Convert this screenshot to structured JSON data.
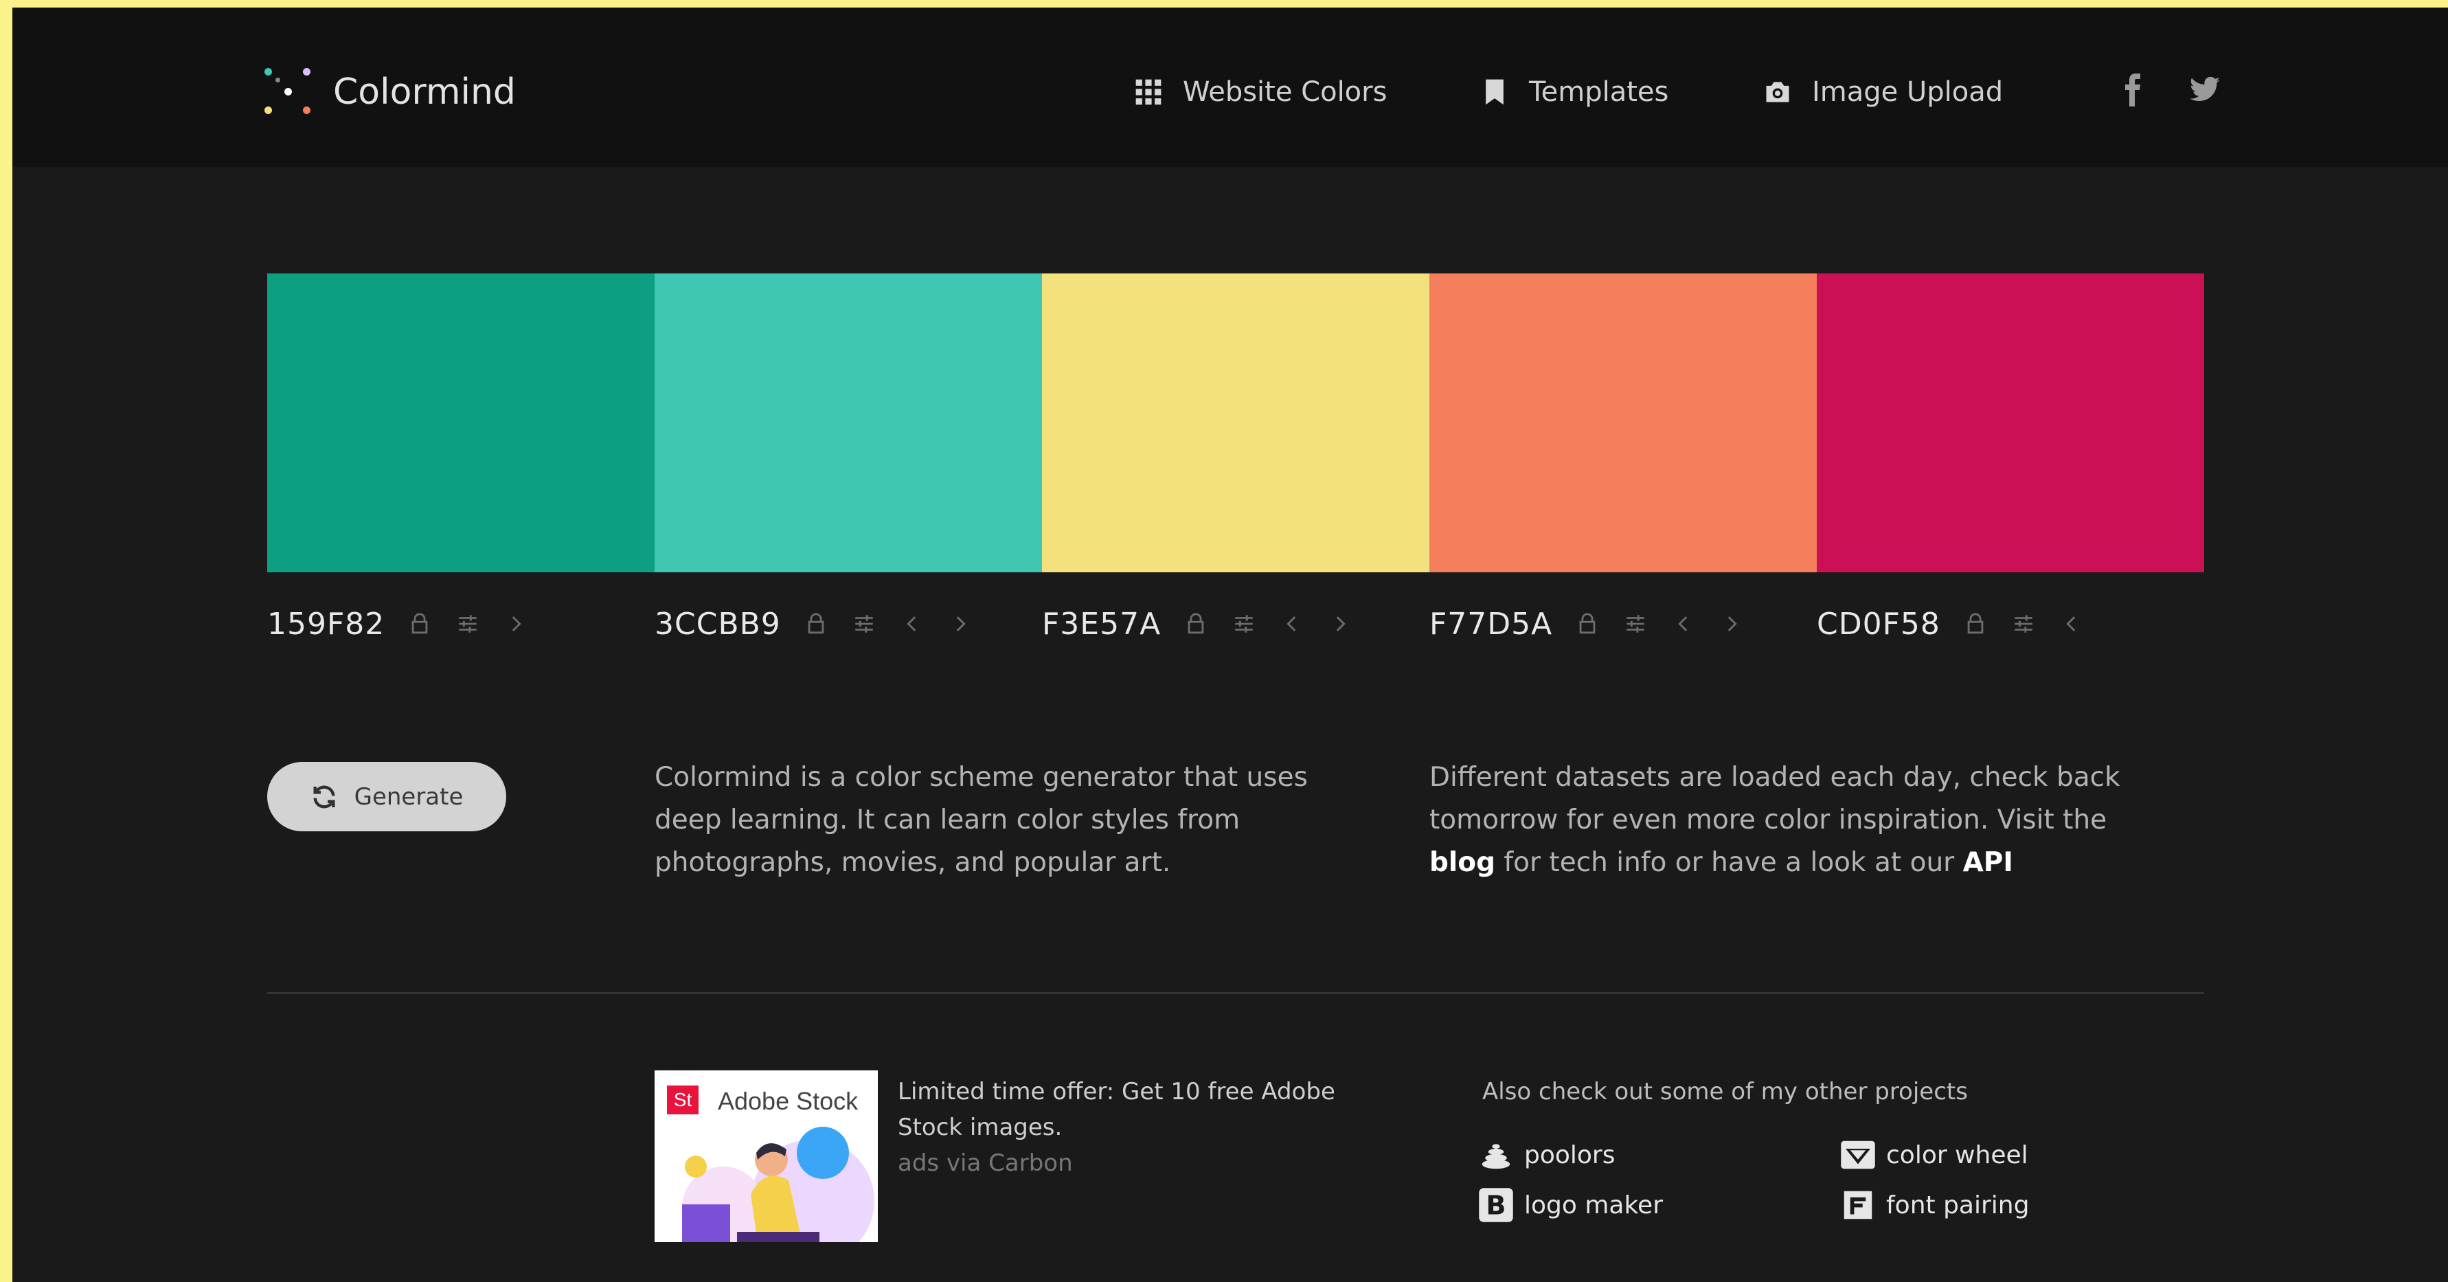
{
  "header": {
    "brand": "Colormind",
    "nav": [
      {
        "label": "Website Colors",
        "icon": "grid-icon"
      },
      {
        "label": "Templates",
        "icon": "bookmark-icon"
      },
      {
        "label": "Image Upload",
        "icon": "camera-icon"
      }
    ],
    "social": [
      {
        "icon": "facebook-icon"
      },
      {
        "icon": "twitter-icon"
      }
    ]
  },
  "palette": [
    {
      "hex": "159F82",
      "color": "#0c9f82",
      "controls": [
        "lock-icon",
        "adjust-icon",
        "chevron-right-icon"
      ]
    },
    {
      "hex": "3CCBB9",
      "color": "#3fc7b4",
      "controls": [
        "lock-icon",
        "adjust-icon",
        "chevron-left-icon",
        "chevron-right-icon"
      ]
    },
    {
      "hex": "F3E57A",
      "color": "#f2e17c",
      "controls": [
        "lock-icon",
        "adjust-icon",
        "chevron-left-icon",
        "chevron-right-icon"
      ]
    },
    {
      "hex": "F77D5A",
      "color": "#f57e5c",
      "controls": [
        "lock-icon",
        "adjust-icon",
        "chevron-left-icon",
        "chevron-right-icon"
      ]
    },
    {
      "hex": "CD0F58",
      "color": "#cc1055",
      "controls": [
        "lock-icon",
        "adjust-icon",
        "chevron-left-icon"
      ]
    }
  ],
  "generate": {
    "label": "Generate",
    "icon": "refresh-icon"
  },
  "intro": {
    "text": "Colormind is a color scheme generator that uses deep learning. It can learn color styles from photographs, movies, and popular art."
  },
  "datasets": {
    "text_before": "Different datasets are loaded each day, check back tomorrow for even more color inspiration. Visit the ",
    "blog_link": "blog",
    "text_middle": " for tech info or have a look at our ",
    "api_link": "API"
  },
  "ad": {
    "brand_badge": "St",
    "brand_name": "Adobe Stock",
    "offer": "Limited time offer: Get 10 free Adobe Stock images.",
    "via": "ads via Carbon"
  },
  "projects": {
    "title": "Also check out some of my other projects",
    "items": [
      {
        "label": "poolors",
        "icon": "stack-icon"
      },
      {
        "label": "color wheel",
        "icon": "wheel-icon"
      },
      {
        "label": "logo maker",
        "icon": "b-logo-icon"
      },
      {
        "label": "font pairing",
        "icon": "font-icon"
      }
    ]
  },
  "colors": {
    "page_border": "#fbf38a",
    "background": "#1a1a1a",
    "header": "#111111",
    "button": "#d3d3d3",
    "link": "#ffffff"
  }
}
